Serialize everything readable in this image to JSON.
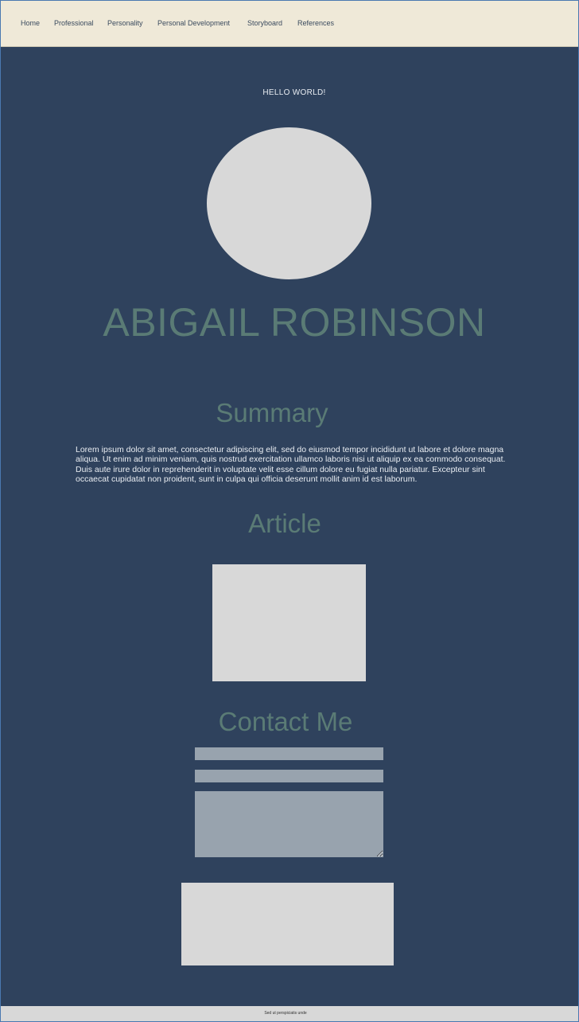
{
  "nav": {
    "items": [
      {
        "label": "Home"
      },
      {
        "label": "Professional"
      },
      {
        "label": "Personality"
      },
      {
        "label": "Personal Development"
      },
      {
        "label": "Storyboard"
      },
      {
        "label": "References"
      }
    ]
  },
  "hero": {
    "greeting": "HELLO WORLD!",
    "name": "ABIGAIL ROBINSON"
  },
  "summary": {
    "heading": "Summary",
    "text": "Lorem ipsum dolor sit amet, consectetur adipiscing elit, sed do eiusmod tempor incididunt ut labore et dolore magna aliqua. Ut enim ad minim veniam, quis nostrud exercitation ullamco laboris nisi ut aliquip ex ea commodo consequat. Duis aute irure dolor in reprehenderit in voluptate velit esse cillum dolore eu fugiat nulla pariatur. Excepteur sint occaecat cupidatat non proident, sunt in culpa qui officia deserunt mollit anim id est laborum."
  },
  "article": {
    "heading": "Article"
  },
  "contact": {
    "heading": "Contact Me"
  },
  "footer": {
    "text": "Sed ut perspiciatis unde"
  },
  "colors": {
    "background": "#2f425d",
    "navbar": "#efe9d8",
    "heading": "#5a7b75",
    "placeholder": "#d8d8d8",
    "field": "#98a3ae"
  }
}
